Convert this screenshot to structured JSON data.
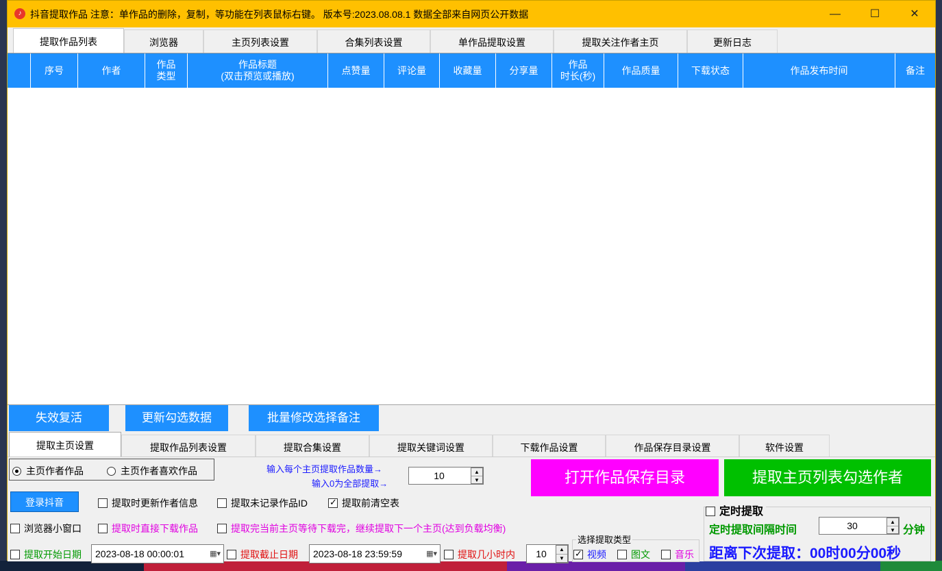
{
  "window": {
    "title": "抖音提取作品  注意：单作品的删除，复制，等功能在列表鼠标右键。 版本号:2023.08.08.1  数据全部来自网页公开数据",
    "minimize_label": "—",
    "maximize_label": "☐",
    "close_label": "✕"
  },
  "main_tabs": [
    "提取作品列表",
    "浏览器",
    "主页列表设置",
    "合集列表设置",
    "单作品提取设置",
    "提取关注作者主页",
    "更新日志"
  ],
  "table": {
    "columns": [
      "",
      "序号",
      "作者",
      "作品\n类型",
      "作品标题\n(双击预览或播放)",
      "点赞量",
      "评论量",
      "收藏量",
      "分享量",
      "作品\n时长(秒)",
      "作品质量",
      "下载状态",
      "作品发布时间",
      "备注"
    ],
    "rows": []
  },
  "action_buttons": [
    "失效复活",
    "更新勾选数据",
    "批量修改选择备注"
  ],
  "sub_tabs": [
    "提取主页设置",
    "提取作品列表设置",
    "提取合集设置",
    "提取关键词设置",
    "下载作品设置",
    "作品保存目录设置",
    "软件设置"
  ],
  "settings": {
    "radio_author_works": "主页作者作品",
    "radio_author_likes": "主页作者喜欢作品",
    "count_hint_line1": "输入每个主页提取作品数量→",
    "count_hint_line2": "输入0为全部提取→",
    "count_value": "10",
    "open_dir_button": "打开作品保存目录",
    "extract_button": "提取主页列表勾选作者",
    "login_button": "登录抖音",
    "cb_update_author": "提取时更新作者信息",
    "cb_unrecorded_id": "提取未记录作品ID",
    "cb_clear_table": "提取前清空表",
    "timer_label": "定时提取",
    "cb_small_browser": "浏览器小窗口",
    "cb_direct_download": "提取时直接下载作品",
    "cb_wait_download": "提取完当前主页等待下载完，继续提取下一个主页(达到负载均衡)",
    "interval_label": "定时提取间隔时间",
    "interval_value": "30",
    "interval_unit": "分钟",
    "start_date_label": "提取开始日期",
    "start_date_value": "2023-08-18 00:00:01",
    "end_date_label": "提取截止日期",
    "end_date_value": "2023-08-18 23:59:59",
    "hours_label": "提取几小时内",
    "hours_value": "10",
    "type_group_label": "选择提取类型",
    "type_video": "视频",
    "type_image": "图文",
    "type_music": "音乐",
    "countdown": "距离下次提取：00时00分00秒"
  },
  "colors": {
    "titlebar": "#ffc000",
    "header_blue": "#1e90ff",
    "magenta": "#ff00ff",
    "green": "#00c000",
    "dark_blue_text": "#1a1aff",
    "green_text": "#009900",
    "magenta_text": "#e000e0"
  }
}
